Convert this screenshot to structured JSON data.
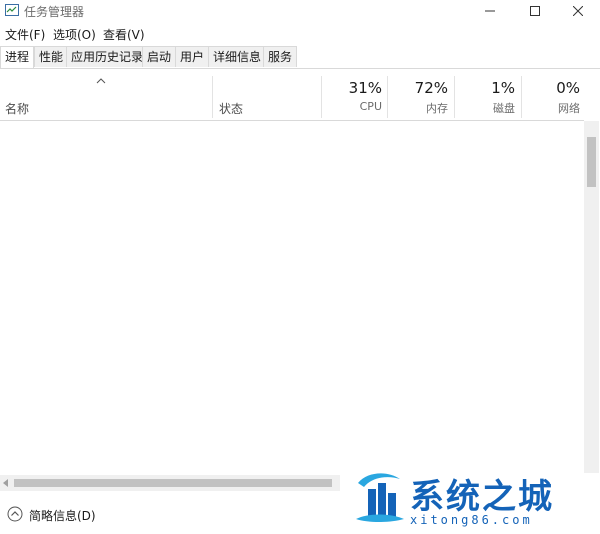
{
  "window": {
    "title": "任务管理器"
  },
  "menu": [
    {
      "label": "文件(F)"
    },
    {
      "label": "选项(O)"
    },
    {
      "label": "查看(V)"
    }
  ],
  "tabs": [
    {
      "label": "进程",
      "active": true
    },
    {
      "label": "性能"
    },
    {
      "label": "应用历史记录"
    },
    {
      "label": "启动"
    },
    {
      "label": "用户"
    },
    {
      "label": "详细信息"
    },
    {
      "label": "服务"
    }
  ],
  "columns": {
    "name": "名称",
    "status": "状态",
    "metrics": [
      {
        "pct": "31%",
        "label": "CPU"
      },
      {
        "pct": "72%",
        "label": "内存"
      },
      {
        "pct": "1%",
        "label": "磁盘"
      },
      {
        "pct": "0%",
        "label": "网络"
      }
    ]
  },
  "footer": {
    "fewer_details": "简略信息(D)"
  },
  "watermark": {
    "title": "系统之城",
    "subtitle": "xitong86.com"
  },
  "colors": {
    "accent": "#1463b8",
    "tab_bg": "#f0f0f0",
    "border": "#d9d9d9"
  }
}
